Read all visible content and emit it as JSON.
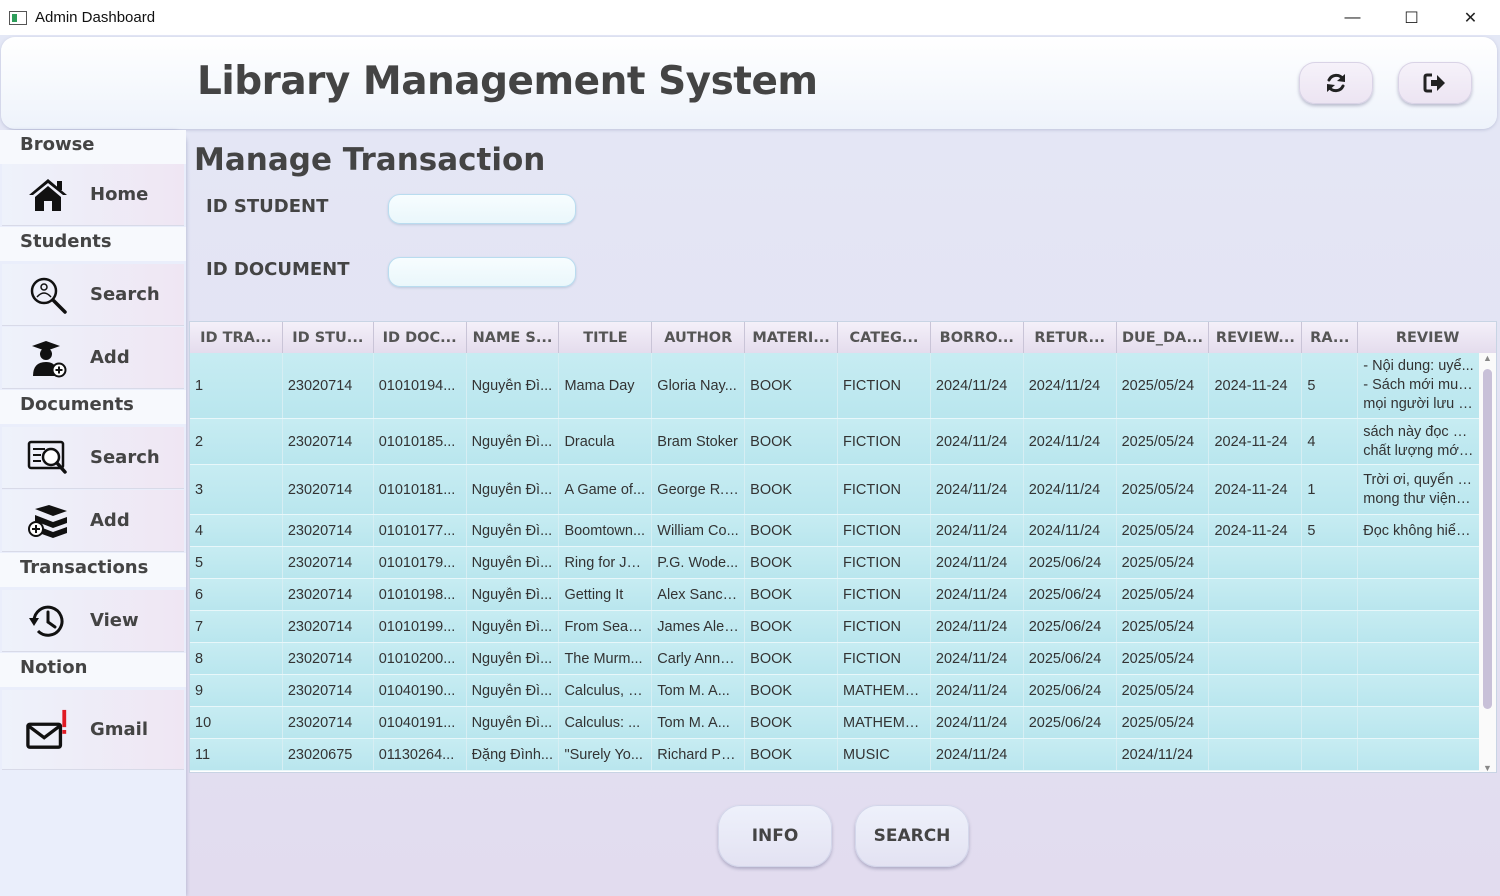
{
  "window": {
    "title": "Admin Dashboard",
    "minimize": "—",
    "maximize": "☐",
    "close": "✕"
  },
  "header": {
    "app_title": "Library Management System",
    "refresh_icon": "refresh-icon",
    "logout_icon": "logout-icon"
  },
  "sidebar": {
    "browse": {
      "label": "Browse",
      "home": "Home"
    },
    "students": {
      "label": "Students",
      "search": "Search",
      "add": "Add"
    },
    "documents": {
      "label": "Documents",
      "search": "Search",
      "add": "Add"
    },
    "transactions": {
      "label": "Transactions",
      "view": "View"
    },
    "notion": {
      "label": "Notion",
      "gmail": "Gmail"
    }
  },
  "main": {
    "page_title": "Manage Transaction",
    "id_student_label": "ID STUDENT",
    "id_student_value": "",
    "id_document_label": "ID DOCUMENT",
    "id_document_value": "",
    "info_button": "INFO",
    "search_button": "SEARCH"
  },
  "table": {
    "columns": [
      "ID TRA...",
      "ID STU...",
      "ID DOC...",
      "NAME S...",
      "TITLE",
      "AUTHOR",
      "MATERI...",
      "CATEG...",
      "BORRO...",
      "RETUR...",
      "DUE_DA...",
      "REVIEW...",
      "RA...",
      "REVIEW"
    ],
    "rows": [
      [
        "1",
        "23020714",
        "01010194...",
        "Nguyễn Đì...",
        "Mama Day",
        "Gloria Nay...",
        "BOOK",
        "FICTION",
        "2024/11/24",
        "2024/11/24",
        "2025/05/24",
        "2024-11-24",
        "5",
        "- Nội dung: uyể...\n- Sách mới mua ...\nmọi người lưu ý ..."
      ],
      [
        "2",
        "23020714",
        "01010185...",
        "Nguyễn Đì...",
        "Dracula",
        "Bram Stoker",
        "BOOK",
        "FICTION",
        "2024/11/24",
        "2024/11/24",
        "2025/05/24",
        "2024-11-24",
        "4",
        "sách này đọc ok...\nchất lượng mới ..."
      ],
      [
        "3",
        "23020714",
        "01010181...",
        "Nguyễn Đì...",
        "A Game of...",
        "George R. ...",
        "BOOK",
        "FICTION",
        "2024/11/24",
        "2024/11/24",
        "2025/05/24",
        "2024-11-24",
        "1",
        "Trời ơi, quyển sá...\nmong thư viện t..."
      ],
      [
        "4",
        "23020714",
        "01010177...",
        "Nguyễn Đì...",
        "Boomtown...",
        "William Co...",
        "BOOK",
        "FICTION",
        "2024/11/24",
        "2024/11/24",
        "2025/05/24",
        "2024-11-24",
        "5",
        "Đọc không hiểu..."
      ],
      [
        "5",
        "23020714",
        "01010179...",
        "Nguyễn Đì...",
        "Ring for Je...",
        "P.G. Wode...",
        "BOOK",
        "FICTION",
        "2024/11/24",
        "2025/06/24",
        "2025/05/24",
        "",
        "",
        ""
      ],
      [
        "6",
        "23020714",
        "01010198...",
        "Nguyễn Đì...",
        "Getting It",
        "Alex Sanch...",
        "BOOK",
        "FICTION",
        "2024/11/24",
        "2025/06/24",
        "2025/05/24",
        "",
        "",
        ""
      ],
      [
        "7",
        "23020714",
        "01010199...",
        "Nguyễn Đì...",
        "From Sea t...",
        "James Alex...",
        "BOOK",
        "FICTION",
        "2024/11/24",
        "2025/06/24",
        "2025/05/24",
        "",
        "",
        ""
      ],
      [
        "8",
        "23020714",
        "01010200...",
        "Nguyễn Đì...",
        "The Murm...",
        "Carly Anne...",
        "BOOK",
        "FICTION",
        "2024/11/24",
        "2025/06/24",
        "2025/05/24",
        "",
        "",
        ""
      ],
      [
        "9",
        "23020714",
        "01040190...",
        "Nguyễn Đì...",
        "Calculus, V...",
        "Tom M. A...",
        "BOOK",
        "MATHEMA...",
        "2024/11/24",
        "2025/06/24",
        "2025/05/24",
        "",
        "",
        ""
      ],
      [
        "10",
        "23020714",
        "01040191...",
        "Nguyễn Đì...",
        "Calculus: ...",
        "Tom M. A...",
        "BOOK",
        "MATHEMA...",
        "2024/11/24",
        "2025/06/24",
        "2025/05/24",
        "",
        "",
        ""
      ],
      [
        "11",
        "23020675",
        "01130264...",
        "Đặng Đình...",
        "\"Surely Yo...",
        "Richard Ph...",
        "BOOK",
        "MUSIC",
        "2024/11/24",
        "",
        "2024/11/24",
        "",
        "",
        ""
      ]
    ]
  }
}
